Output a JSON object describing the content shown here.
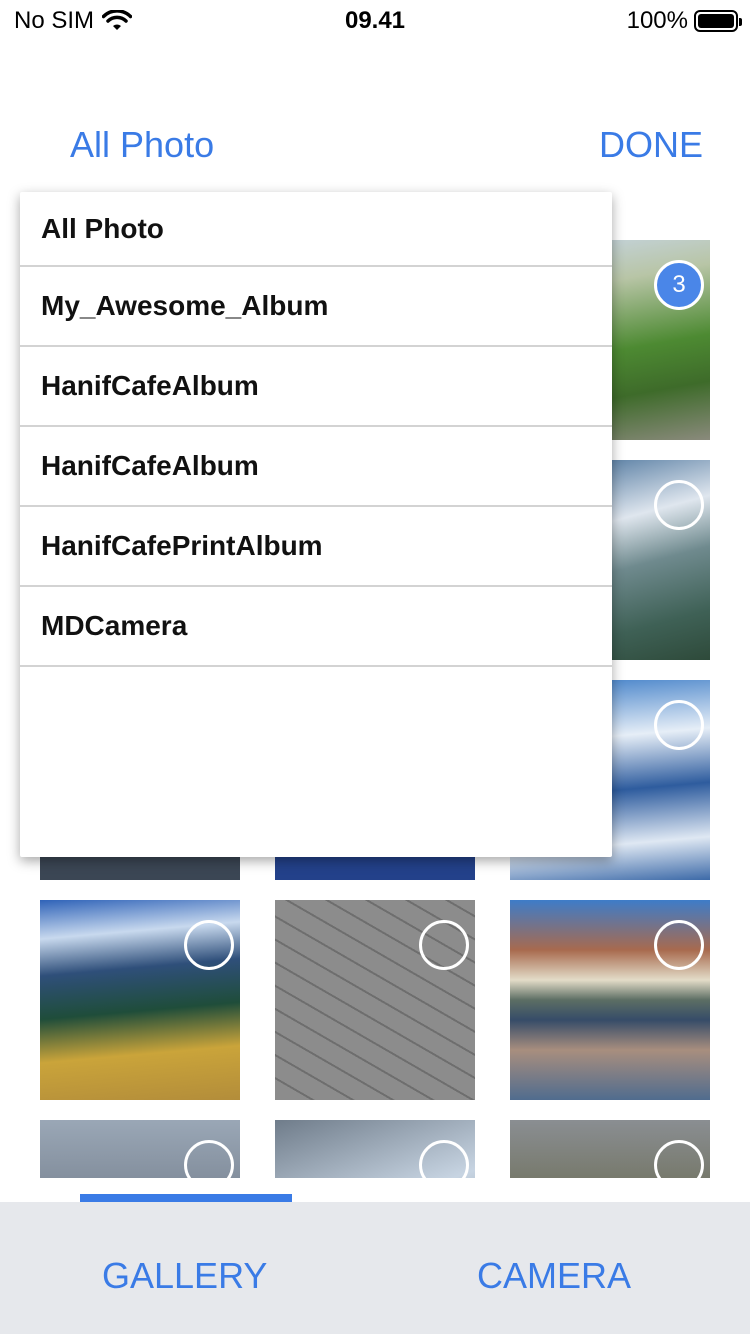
{
  "status_bar": {
    "carrier": "No SIM",
    "time": "09.41",
    "battery": "100%",
    "icons": [
      "wifi-icon",
      "battery-icon"
    ]
  },
  "nav": {
    "album_selector": "All Photo",
    "done": "DONE"
  },
  "album_dropdown": {
    "items": [
      {
        "label": "All Photo"
      },
      {
        "label": "My_Awesome_Album"
      },
      {
        "label": "HanifCafeAlbum"
      },
      {
        "label": "HanifCafeAlbum"
      },
      {
        "label": "HanifCafePrintAlbum"
      },
      {
        "label": "MDCamera"
      }
    ]
  },
  "photo_grid": {
    "photos": [
      {
        "desc": "green hills",
        "selected_index": "3"
      },
      {
        "desc": "snowy mountain peaks",
        "selected_index": ""
      },
      {
        "desc": "mountain lake",
        "selected_index": ""
      },
      {
        "desc": "blue mountains road",
        "selected_index": ""
      },
      {
        "desc": "paving bricks",
        "selected_index": ""
      },
      {
        "desc": "mountain reflection lake",
        "selected_index": ""
      },
      {
        "desc": "building roof",
        "selected_index": ""
      },
      {
        "desc": "building and sky",
        "selected_index": ""
      },
      {
        "desc": "plants by wall",
        "selected_index": ""
      }
    ]
  },
  "tabs": {
    "gallery": "GALLERY",
    "camera": "CAMERA",
    "active": "gallery"
  },
  "colors": {
    "accent": "#3a7be6",
    "selected_badge": "#4a86e8",
    "tabbar_bg": "#e6e8ec"
  }
}
